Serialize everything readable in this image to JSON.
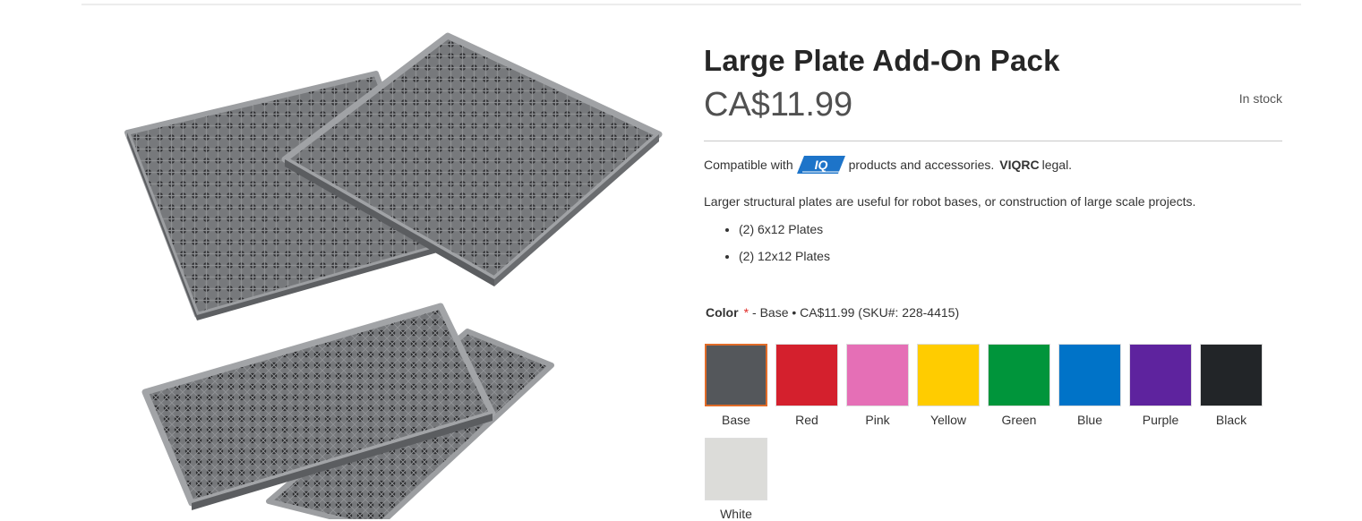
{
  "product": {
    "title": "Large Plate Add-On Pack",
    "price": "CA$11.99",
    "stock": "In stock",
    "compat_prefix": "Compatible with",
    "compat_badge": "IQ",
    "compat_suffix": "products and accessories.",
    "compat_legal_bold": "VIQRC",
    "compat_legal": "legal.",
    "description": "Larger structural plates are useful for robot bases, or construction of large scale projects.",
    "contents": [
      "(2) 6x12 Plates",
      "(2) 12x12 Plates"
    ]
  },
  "color_option": {
    "label": "Color",
    "required_mark": "*",
    "selected_info": "- Base • CA$11.99 (SKU#: 228-4415)",
    "selected": "Base",
    "swatches": [
      {
        "name": "Base",
        "color": "#54575b"
      },
      {
        "name": "Red",
        "color": "#d4202d"
      },
      {
        "name": "Pink",
        "color": "#e56fb6"
      },
      {
        "name": "Yellow",
        "color": "#ffcc00"
      },
      {
        "name": "Green",
        "color": "#00953b"
      },
      {
        "name": "Blue",
        "color": "#0073c8"
      },
      {
        "name": "Purple",
        "color": "#5e239e"
      },
      {
        "name": "Black",
        "color": "#222528"
      },
      {
        "name": "White",
        "color": "#dcdcd9"
      }
    ]
  },
  "colors": {
    "badge_blue": "#1d74c9",
    "accent_orange": "#e06b28",
    "plate_gray": "#6f7275"
  }
}
